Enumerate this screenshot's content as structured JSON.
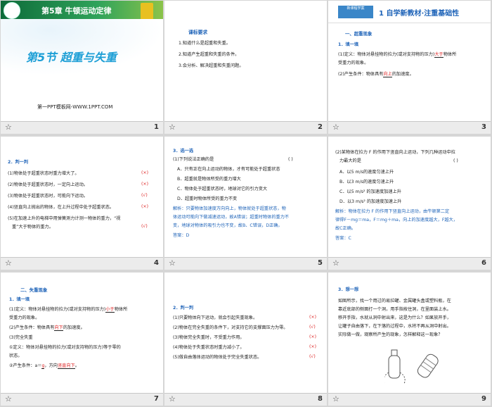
{
  "slides": [
    {
      "num": "1",
      "chapter": "第5章 牛顿运动定律",
      "title": "第5节  超重与失重",
      "site": "第一PPT模板网-WWW.1PPT.COM"
    },
    {
      "num": "2",
      "heading": "课标要求",
      "lines": [
        "1.知道什么是超重和失重。",
        "2.知道产生超重和失重的条件。",
        "3.会分析、解决超重和失重问题。"
      ]
    },
    {
      "num": "3",
      "logo": "新课程学案",
      "title": "1 自学新教材·注重基础性",
      "section": "一、超重现象",
      "sub": "1．填一填",
      "l1a": "(1)定义：物体对悬挂物的拉力(或对支持物的压力)",
      "l1b": "大于",
      "l1c": "物体所",
      "l2": "受重力的现象。",
      "l3a": "(2)产生条件：物体具有",
      "l3b": "向上",
      "l3c": "的加速度。"
    },
    {
      "num": "4",
      "sub": "2．判一判",
      "items": [
        {
          "t": "(1)物体处于超重状态时重力增大了。",
          "m": "(×)"
        },
        {
          "t": "(2)物体处于超重状态时，一定向上运动。",
          "m": "(×)"
        },
        {
          "t": "(3)物体处于超重状态时，可能向下运动。",
          "m": "(√)"
        },
        {
          "t": "(4)竖直向上抛出的物体，在上升过程中处于超重状态。",
          "m": "(×)"
        },
        {
          "t": "(5)在加速上升的电梯中用弹簧测力计测一物体的重力，“视",
          "m": ""
        },
        {
          "t": "重”大于物体的重力。",
          "m": "(√)"
        }
      ]
    },
    {
      "num": "5",
      "sub": "3．选一选",
      "q": "(1)下列说法正确的是",
      "bracket": "(        )",
      "opts": [
        "A．只有正在向上运动的物体，才有可能处于超重状态",
        "B．超重就是物体所受的重力增大",
        "C．物体处于超重状态时，地球对它的引力变大",
        "D．超重时物体所受的重力不变"
      ],
      "jx": [
        "解析：只要物体加速度方向向上，物体就处于超重状态，物",
        "体运动可能向下做减速运动，故A错误；超重时物体的重力不",
        "变，地球对物体的吸引力也不变，故B、C错误，D正确。"
      ],
      "ans": "答案：D"
    },
    {
      "num": "6",
      "q1": "(2)某物体在拉力 F 的作用下竖直向上运动，下列几种运动中拉",
      "q2": "力最大的是",
      "bracket": "(        )",
      "opts": [
        "A．以5 m/s的速度匀速上升",
        "B．以3 m/s的速度匀速上升",
        "C．以5 m/s² 的加速度加速上升",
        "D．以3 m/s² 的加速度加速上升"
      ],
      "jx": [
        "解析：物体在拉力 F 的作用下竖直向上运动，由牛顿第二定",
        "律得F－mg＝ma，F＝mg＋ma，向上的加速度越大，F越大，",
        "故C正确。"
      ],
      "ans": "答案：C"
    },
    {
      "num": "7",
      "section": "二、失重现象",
      "sub": "1．填一填",
      "l1a": "(1)定义：物体对悬挂物的拉力(或对支持物的压力)",
      "l1b": "小于",
      "l1c": "物体所",
      "l2": "受重力的现象。",
      "l3a": "(2)产生条件：物体具有",
      "l3b": "向下",
      "l3c": "的加速度。",
      "l4": "(3)完全失重",
      "l5": "①定义：物体对悬挂物的拉力(或对支持物的压力)等于零的",
      "l6": "状态。",
      "l7a": "②产生条件：a＝",
      "l7b": "g",
      "l7c": "，方向",
      "l7d": "竖直向下",
      "l7e": "。"
    },
    {
      "num": "8",
      "sub": "2．判一判",
      "items": [
        {
          "t": "(1)只要物体向下运动，就会引起失重现象。",
          "m": "(×)"
        },
        {
          "t": "(2)物体在完全失重的条件下，对支持它的支撑面压力为零。",
          "m": "(√)"
        },
        {
          "t": "(3)物体完全失重时，不受重力作用。",
          "m": "(×)"
        },
        {
          "t": "(4)物体处于失重状态时重力减小了。",
          "m": "(×)"
        },
        {
          "t": "(5)做自由落体运动的物体处于完全失重状态。",
          "m": "(√)"
        }
      ]
    },
    {
      "num": "9",
      "sub": "3．想一想",
      "lines": [
        "如图所示，找一个用过的易拉罐、金属罐头盒或塑料瓶，在",
        "靠近底部的侧面打一个洞，用手指按住洞，在里面装上水。",
        "移开手指，水就从洞中射出来，这是为什么？如果放开手，",
        "让罐子自由落下，在下落的过程中，水将不再从洞中射出。",
        "实际做一做，观察所产生的现象，怎样解释这一现象？"
      ]
    }
  ],
  "colors": {
    "accent": "#1e63b8",
    "red": "#dd2222"
  }
}
